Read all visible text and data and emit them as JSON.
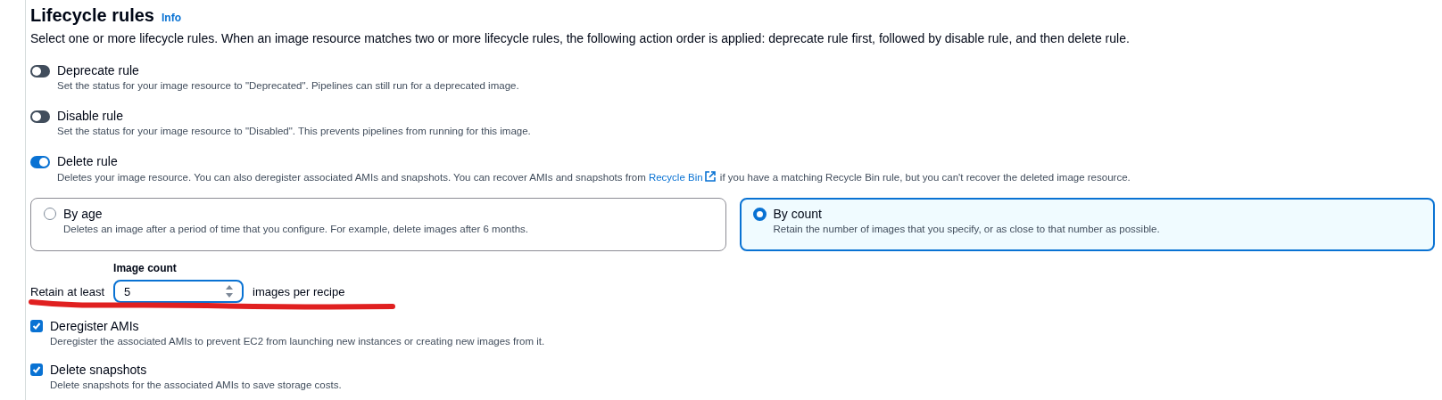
{
  "section": {
    "title": "Lifecycle rules",
    "info_link": "Info",
    "description": "Select one or more lifecycle rules. When an image resource matches two or more lifecycle rules, the following action order is applied: deprecate rule first, followed by disable rule, and then delete rule."
  },
  "rules": [
    {
      "label": "Deprecate rule",
      "on": false,
      "description": "Set the status for your image resource to \"Deprecated\". Pipelines can still run for a deprecated image."
    },
    {
      "label": "Disable rule",
      "on": false,
      "description": "Set the status for your image resource to \"Disabled\". This prevents pipelines from running for this image."
    },
    {
      "label": "Delete rule",
      "on": true,
      "description_before": "Deletes your image resource. You can also deregister associated AMIs and snapshots. You can recover AMIs and snapshots from",
      "link": "Recycle Bin",
      "description_after": "if you have a matching Recycle Bin rule, but you can't recover the deleted image resource."
    }
  ],
  "options": [
    {
      "label": "By age",
      "selected": false,
      "description": "Deletes an image after a period of time that you configure. For example, delete images after 6 months."
    },
    {
      "label": "By count",
      "selected": true,
      "description": "Retain the number of images that you specify, or as close to that number as possible."
    }
  ],
  "image_count": {
    "label": "Image count",
    "prefix": "Retain at least",
    "value": "5",
    "suffix": "images per recipe"
  },
  "checkboxes": [
    {
      "label": "Deregister AMIs",
      "checked": true,
      "description": "Deregister the associated AMIs to prevent EC2 from launching new instances or creating new images from it."
    },
    {
      "label": "Delete snapshots",
      "checked": true,
      "description": "Delete snapshots for the associated AMIs to save storage costs."
    }
  ]
}
